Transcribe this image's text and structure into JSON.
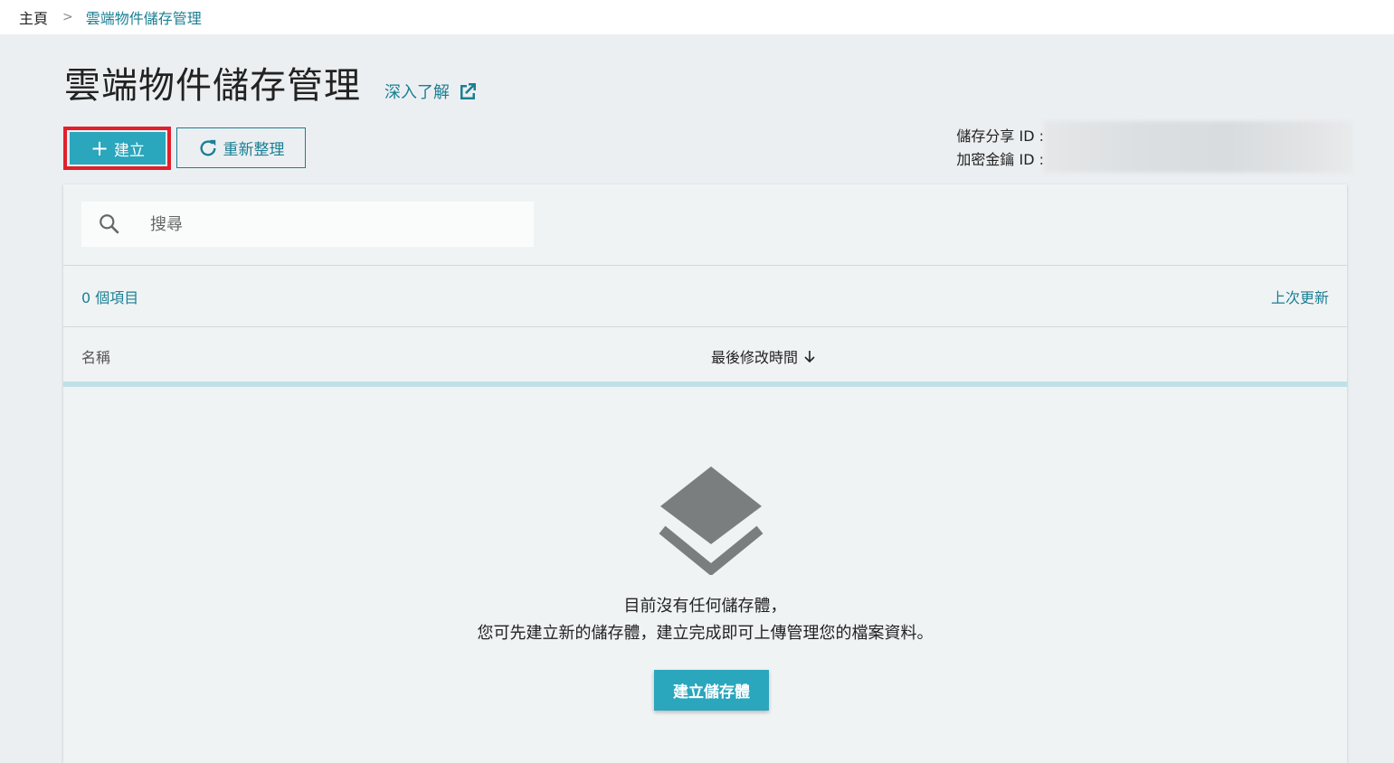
{
  "breadcrumb": {
    "home": "主頁",
    "separator": ">",
    "current": "雲端物件儲存管理"
  },
  "page": {
    "title": "雲端物件儲存管理",
    "learn_more": "深入了解",
    "learn_more_icon": "external-link-icon"
  },
  "toolbar": {
    "create_label": "建立",
    "create_icon": "plus-icon",
    "refresh_label": "重新整理",
    "refresh_icon": "refresh-icon"
  },
  "ids": {
    "storage_share_label": "儲存分享 ID :",
    "encryption_key_label": "加密金鑰 ID :"
  },
  "search": {
    "placeholder": "搜尋",
    "value": "",
    "icon": "search-icon"
  },
  "list": {
    "count": "0 個項目",
    "last_updated": "上次更新"
  },
  "table": {
    "columns": {
      "name": "名稱",
      "modified": "最後修改時間"
    },
    "sort_icon": "arrow-down-icon"
  },
  "empty_state": {
    "icon": "layers-icon",
    "line1": "目前沒有任何儲存體，",
    "line2": "您可先建立新的儲存體，建立完成即可上傳管理您的檔案資料。",
    "button": "建立儲存體"
  },
  "colors": {
    "accent": "#2aa6bd",
    "link": "#1a7f94",
    "highlight": "#e0202c",
    "icon_gray": "#7b7e7f"
  }
}
